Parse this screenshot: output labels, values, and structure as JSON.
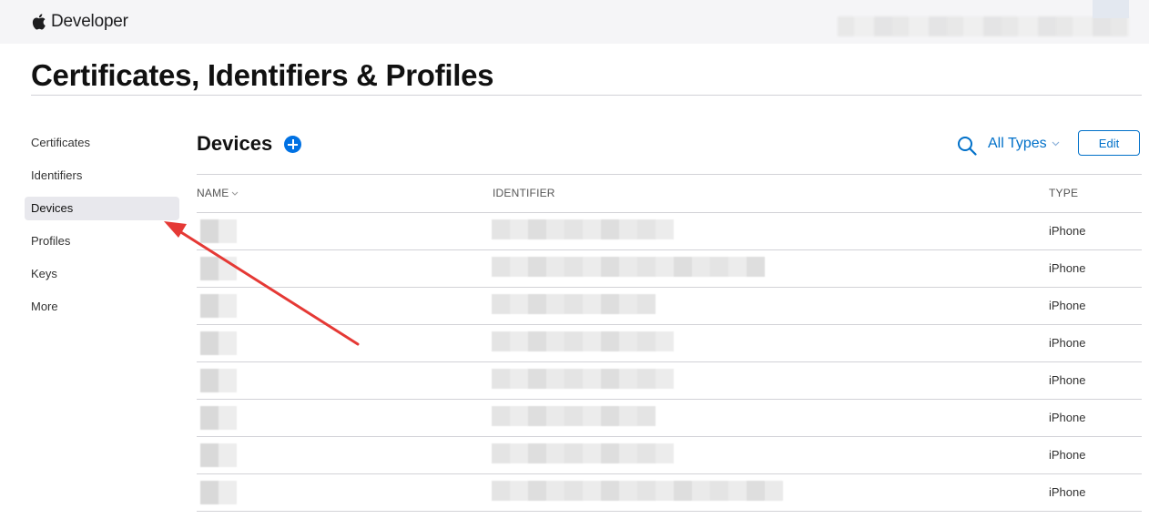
{
  "header": {
    "brand": "Developer"
  },
  "page_title": "Certificates, Identifiers & Profiles",
  "sidebar": {
    "items": [
      {
        "label": "Certificates"
      },
      {
        "label": "Identifiers"
      },
      {
        "label": "Devices",
        "active": true
      },
      {
        "label": "Profiles"
      },
      {
        "label": "Keys"
      },
      {
        "label": "More"
      }
    ]
  },
  "section": {
    "title": "Devices",
    "filter_label": "All Types",
    "edit_label": "Edit"
  },
  "table": {
    "headers": {
      "name": "NAME",
      "identifier": "IDENTIFIER",
      "type": "TYPE"
    },
    "rows": [
      {
        "type": "iPhone"
      },
      {
        "type": "iPhone"
      },
      {
        "type": "iPhone"
      },
      {
        "type": "iPhone"
      },
      {
        "type": "iPhone"
      },
      {
        "type": "iPhone"
      },
      {
        "type": "iPhone"
      },
      {
        "type": "iPhone"
      }
    ]
  },
  "colors": {
    "accent": "#0070c9",
    "annotation_arrow": "#e53935"
  }
}
